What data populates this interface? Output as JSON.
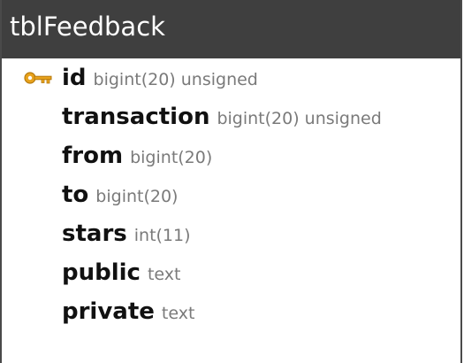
{
  "table": {
    "name": "tblFeedback",
    "columns": [
      {
        "name": "id",
        "type": "bigint(20) unsigned",
        "primary_key": true
      },
      {
        "name": "transaction",
        "type": "bigint(20) unsigned",
        "primary_key": false
      },
      {
        "name": "from",
        "type": "bigint(20)",
        "primary_key": false
      },
      {
        "name": "to",
        "type": "bigint(20)",
        "primary_key": false
      },
      {
        "name": "stars",
        "type": "int(11)",
        "primary_key": false
      },
      {
        "name": "public",
        "type": "text",
        "primary_key": false
      },
      {
        "name": "private",
        "type": "text",
        "primary_key": false
      }
    ]
  },
  "colors": {
    "header_bg": "#3f3f3f",
    "header_text": "#ffffff",
    "column_name": "#111111",
    "column_type": "#7a7a7a",
    "key_icon": "#e8a21c"
  },
  "icons": {
    "primary_key": "key-icon"
  }
}
